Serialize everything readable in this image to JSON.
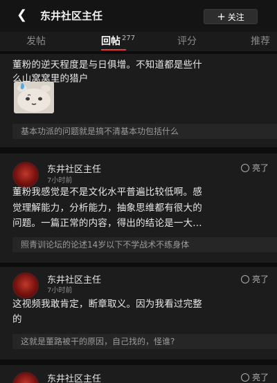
{
  "header": {
    "title": "东井社区主任",
    "back_icon": "chevron-left-icon",
    "follow_label": "关注",
    "follow_plus": "+",
    "more_icon": "more-icon"
  },
  "tabs": [
    {
      "label": "发帖",
      "count": ""
    },
    {
      "label": "回帖",
      "count": "277"
    },
    {
      "label": "评分",
      "count": ""
    },
    {
      "label": "推荐",
      "count": ""
    }
  ],
  "posts": [
    {
      "lines": [
        "董粉的逆天程度是与日俱增。不知道都是些什",
        "么山窝窝里的猎户"
      ],
      "has_sticker": true,
      "quote": "基本功派的问题就是搞不清基本功包括什么"
    },
    {
      "author": "东井社区主任",
      "time": "7小时前",
      "light": "亮了",
      "lines": [
        "董粉我感觉是不是文化水平普遍比较低啊。感",
        "觉理解能力，分析能力，抽象思维都有很大的",
        "问题。一篇正常的内容，得出的结论是一大..."
      ],
      "quote": "照青训论坛的论述14岁以下不学战术不练身体"
    },
    {
      "author": "东井社区主任",
      "time": "7小时前",
      "light": "亮了",
      "lines": [
        "这视频我敢肯定，断章取义。因为我看过完整",
        "的"
      ],
      "quote": "这就是董路被干的原因，自己找的，怪谁?"
    },
    {
      "author": "东井社区主任",
      "light": "亮了"
    }
  ],
  "colors": {
    "accent": "#e33a3a",
    "background": "#151515",
    "card": "#1c1c1c",
    "quote_bg": "#262626"
  }
}
